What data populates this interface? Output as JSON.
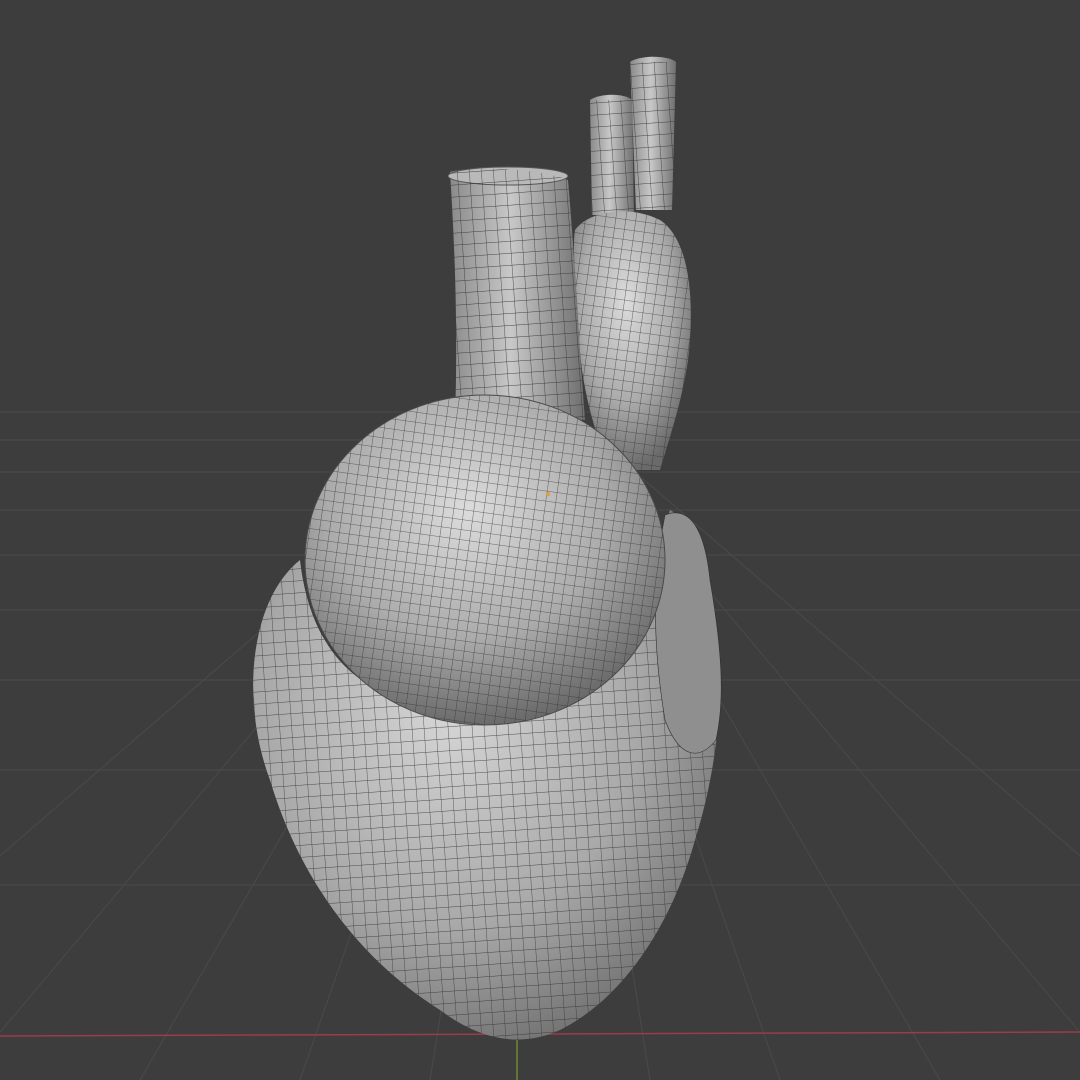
{
  "viewport": {
    "background_color": "#3d3d3d",
    "grid_line_color": "#4a4a4a",
    "x_axis_color": "#9a3c4a",
    "y_axis_color": "#6f8a2e",
    "origin_marker_color": "#d7a04a",
    "shading_mode": "solid",
    "wireframe_overlay": true
  },
  "object": {
    "name": "heart-mesh",
    "base_color": "#9e9e9e",
    "highlight_color": "#d8d8d8",
    "shadow_color": "#5a5a5a",
    "wire_color": "#2b2b2b"
  }
}
